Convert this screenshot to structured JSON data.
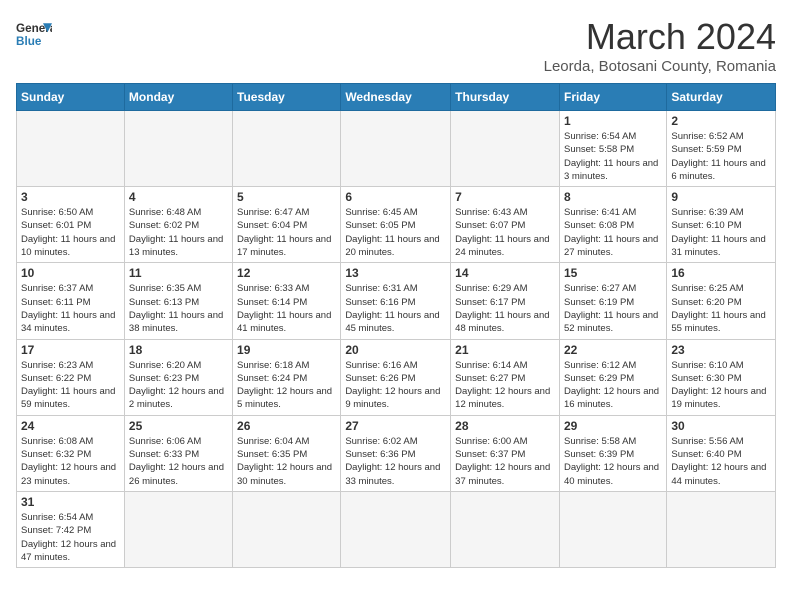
{
  "header": {
    "logo_general": "General",
    "logo_blue": "Blue",
    "month_title": "March 2024",
    "subtitle": "Leorda, Botosani County, Romania"
  },
  "weekdays": [
    "Sunday",
    "Monday",
    "Tuesday",
    "Wednesday",
    "Thursday",
    "Friday",
    "Saturday"
  ],
  "weeks": [
    [
      {
        "day": "",
        "info": ""
      },
      {
        "day": "",
        "info": ""
      },
      {
        "day": "",
        "info": ""
      },
      {
        "day": "",
        "info": ""
      },
      {
        "day": "",
        "info": ""
      },
      {
        "day": "1",
        "info": "Sunrise: 6:54 AM\nSunset: 5:58 PM\nDaylight: 11 hours and 3 minutes."
      },
      {
        "day": "2",
        "info": "Sunrise: 6:52 AM\nSunset: 5:59 PM\nDaylight: 11 hours and 6 minutes."
      }
    ],
    [
      {
        "day": "3",
        "info": "Sunrise: 6:50 AM\nSunset: 6:01 PM\nDaylight: 11 hours and 10 minutes."
      },
      {
        "day": "4",
        "info": "Sunrise: 6:48 AM\nSunset: 6:02 PM\nDaylight: 11 hours and 13 minutes."
      },
      {
        "day": "5",
        "info": "Sunrise: 6:47 AM\nSunset: 6:04 PM\nDaylight: 11 hours and 17 minutes."
      },
      {
        "day": "6",
        "info": "Sunrise: 6:45 AM\nSunset: 6:05 PM\nDaylight: 11 hours and 20 minutes."
      },
      {
        "day": "7",
        "info": "Sunrise: 6:43 AM\nSunset: 6:07 PM\nDaylight: 11 hours and 24 minutes."
      },
      {
        "day": "8",
        "info": "Sunrise: 6:41 AM\nSunset: 6:08 PM\nDaylight: 11 hours and 27 minutes."
      },
      {
        "day": "9",
        "info": "Sunrise: 6:39 AM\nSunset: 6:10 PM\nDaylight: 11 hours and 31 minutes."
      }
    ],
    [
      {
        "day": "10",
        "info": "Sunrise: 6:37 AM\nSunset: 6:11 PM\nDaylight: 11 hours and 34 minutes."
      },
      {
        "day": "11",
        "info": "Sunrise: 6:35 AM\nSunset: 6:13 PM\nDaylight: 11 hours and 38 minutes."
      },
      {
        "day": "12",
        "info": "Sunrise: 6:33 AM\nSunset: 6:14 PM\nDaylight: 11 hours and 41 minutes."
      },
      {
        "day": "13",
        "info": "Sunrise: 6:31 AM\nSunset: 6:16 PM\nDaylight: 11 hours and 45 minutes."
      },
      {
        "day": "14",
        "info": "Sunrise: 6:29 AM\nSunset: 6:17 PM\nDaylight: 11 hours and 48 minutes."
      },
      {
        "day": "15",
        "info": "Sunrise: 6:27 AM\nSunset: 6:19 PM\nDaylight: 11 hours and 52 minutes."
      },
      {
        "day": "16",
        "info": "Sunrise: 6:25 AM\nSunset: 6:20 PM\nDaylight: 11 hours and 55 minutes."
      }
    ],
    [
      {
        "day": "17",
        "info": "Sunrise: 6:23 AM\nSunset: 6:22 PM\nDaylight: 11 hours and 59 minutes."
      },
      {
        "day": "18",
        "info": "Sunrise: 6:20 AM\nSunset: 6:23 PM\nDaylight: 12 hours and 2 minutes."
      },
      {
        "day": "19",
        "info": "Sunrise: 6:18 AM\nSunset: 6:24 PM\nDaylight: 12 hours and 5 minutes."
      },
      {
        "day": "20",
        "info": "Sunrise: 6:16 AM\nSunset: 6:26 PM\nDaylight: 12 hours and 9 minutes."
      },
      {
        "day": "21",
        "info": "Sunrise: 6:14 AM\nSunset: 6:27 PM\nDaylight: 12 hours and 12 minutes."
      },
      {
        "day": "22",
        "info": "Sunrise: 6:12 AM\nSunset: 6:29 PM\nDaylight: 12 hours and 16 minutes."
      },
      {
        "day": "23",
        "info": "Sunrise: 6:10 AM\nSunset: 6:30 PM\nDaylight: 12 hours and 19 minutes."
      }
    ],
    [
      {
        "day": "24",
        "info": "Sunrise: 6:08 AM\nSunset: 6:32 PM\nDaylight: 12 hours and 23 minutes."
      },
      {
        "day": "25",
        "info": "Sunrise: 6:06 AM\nSunset: 6:33 PM\nDaylight: 12 hours and 26 minutes."
      },
      {
        "day": "26",
        "info": "Sunrise: 6:04 AM\nSunset: 6:35 PM\nDaylight: 12 hours and 30 minutes."
      },
      {
        "day": "27",
        "info": "Sunrise: 6:02 AM\nSunset: 6:36 PM\nDaylight: 12 hours and 33 minutes."
      },
      {
        "day": "28",
        "info": "Sunrise: 6:00 AM\nSunset: 6:37 PM\nDaylight: 12 hours and 37 minutes."
      },
      {
        "day": "29",
        "info": "Sunrise: 5:58 AM\nSunset: 6:39 PM\nDaylight: 12 hours and 40 minutes."
      },
      {
        "day": "30",
        "info": "Sunrise: 5:56 AM\nSunset: 6:40 PM\nDaylight: 12 hours and 44 minutes."
      }
    ],
    [
      {
        "day": "31",
        "info": "Sunrise: 6:54 AM\nSunset: 7:42 PM\nDaylight: 12 hours and 47 minutes."
      },
      {
        "day": "",
        "info": ""
      },
      {
        "day": "",
        "info": ""
      },
      {
        "day": "",
        "info": ""
      },
      {
        "day": "",
        "info": ""
      },
      {
        "day": "",
        "info": ""
      },
      {
        "day": "",
        "info": ""
      }
    ]
  ]
}
